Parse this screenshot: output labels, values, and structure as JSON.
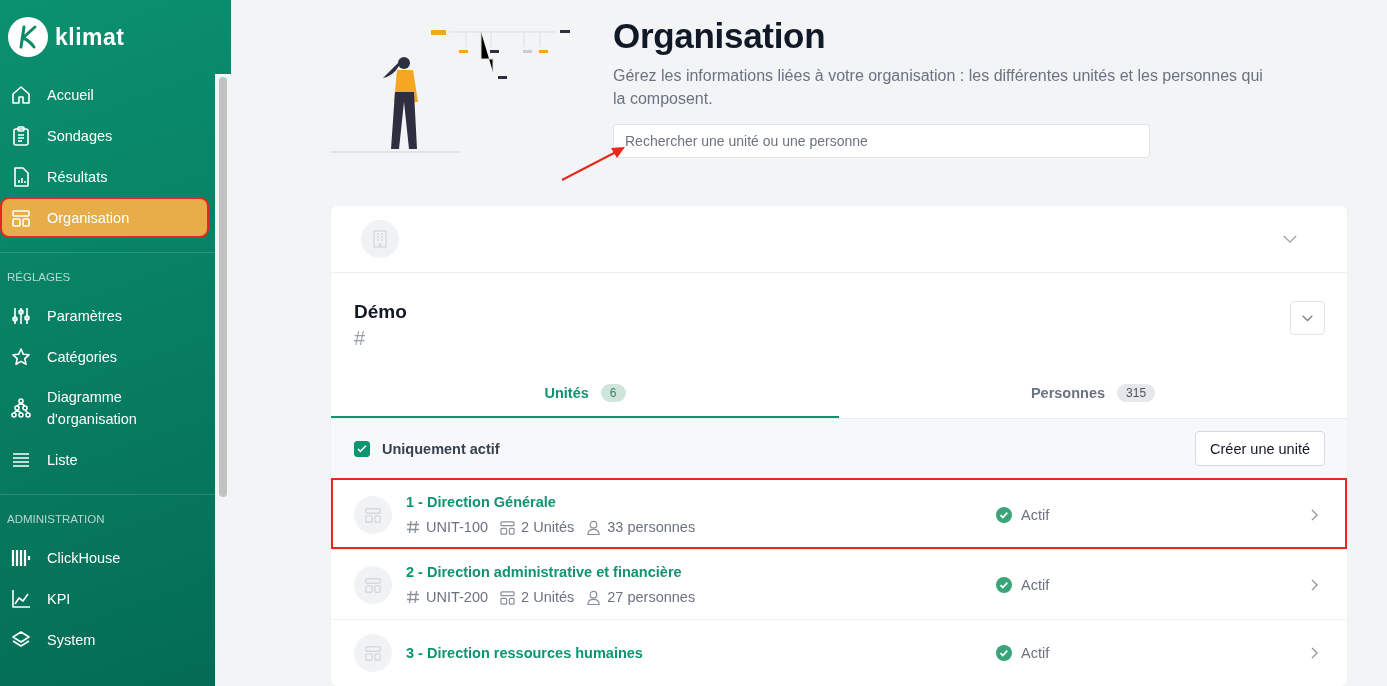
{
  "sidebar": {
    "brand": "klimat",
    "sections": [
      {
        "items": [
          {
            "label": "Accueil",
            "selected": false
          },
          {
            "label": "Sondages",
            "selected": false
          },
          {
            "label": "Résultats",
            "selected": false
          },
          {
            "label": "Organisation",
            "selected": true,
            "highlighted": true
          }
        ]
      },
      {
        "heading": "RÉGLAGES",
        "items": [
          {
            "label": "Paramètres",
            "selected": false
          },
          {
            "label": "Catégories",
            "selected": false
          },
          {
            "label": "Diagramme d'organisation",
            "selected": false
          },
          {
            "label": "Liste",
            "selected": false
          }
        ]
      },
      {
        "heading": "ADMINISTRATION",
        "items": [
          {
            "label": "ClickHouse",
            "selected": false
          },
          {
            "label": "KPI",
            "selected": false
          },
          {
            "label": "System",
            "selected": false
          }
        ]
      }
    ]
  },
  "header": {
    "title": "Organisation",
    "description": "Gérez les informations liées à votre organisation : les différentes unités et les personnes qui la composent.",
    "search": {
      "placeholder": "Rechercher une unité ou une personne"
    }
  },
  "card": {
    "name": "Démo",
    "hash": "#",
    "tabs": [
      {
        "label": "Unités",
        "count": "6",
        "selected": true
      },
      {
        "label": "Personnes",
        "count": "315",
        "selected": false
      }
    ],
    "filter": {
      "label": "Uniquement actif",
      "checked": true
    },
    "create_button": "Créer une unité",
    "units": [
      {
        "title": "1 - Direction Générale",
        "code": "UNIT-100",
        "units": "2 Unités",
        "persons": "33 personnes",
        "status": "Actif",
        "active": true,
        "highlighted": true
      },
      {
        "title": "2 - Direction administrative et financière",
        "code": "UNIT-200",
        "units": "2 Unités",
        "persons": "27 personnes",
        "status": "Actif",
        "active": true,
        "highlighted": false
      },
      {
        "title": "3 - Direction ressources humaines",
        "status": "Actif",
        "active": true,
        "highlighted": false
      }
    ]
  }
}
